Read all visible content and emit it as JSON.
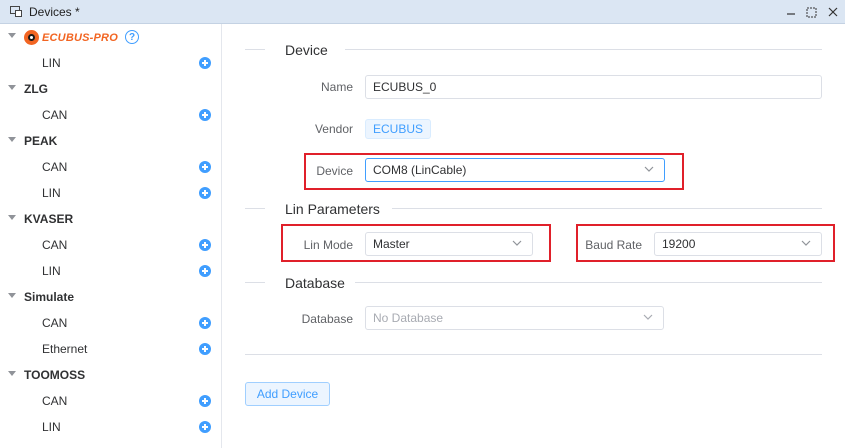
{
  "window": {
    "title": "Devices *",
    "icon": "devices-icon"
  },
  "sidebar": {
    "groups": [
      {
        "name": "ECUBUS-PRO",
        "logo": true,
        "help_icon": "question-circle-icon",
        "items": [
          "LIN"
        ]
      },
      {
        "name": "ZLG",
        "items": [
          "CAN"
        ]
      },
      {
        "name": "PEAK",
        "items": [
          "CAN",
          "LIN"
        ]
      },
      {
        "name": "KVASER",
        "items": [
          "CAN",
          "LIN"
        ]
      },
      {
        "name": "Simulate",
        "items": [
          "CAN",
          "Ethernet"
        ]
      },
      {
        "name": "TOOMOSS",
        "items": [
          "CAN",
          "LIN"
        ]
      }
    ]
  },
  "form": {
    "device_section": "Device",
    "name_label": "Name",
    "name_value": "ECUBUS_0",
    "vendor_label": "Vendor",
    "vendor_value": "ECUBUS",
    "device_label": "Device",
    "device_value": "COM8 (LinCable)",
    "lin_section": "Lin Parameters",
    "lin_mode_label": "Lin Mode",
    "lin_mode_value": "Master",
    "baud_label": "Baud Rate",
    "baud_value": "19200",
    "db_section": "Database",
    "db_label": "Database",
    "db_placeholder": "No Database",
    "add_button": "Add Device"
  },
  "colors": {
    "accent": "#409eff",
    "brand": "#f26522",
    "highlight": "#e0202a"
  }
}
